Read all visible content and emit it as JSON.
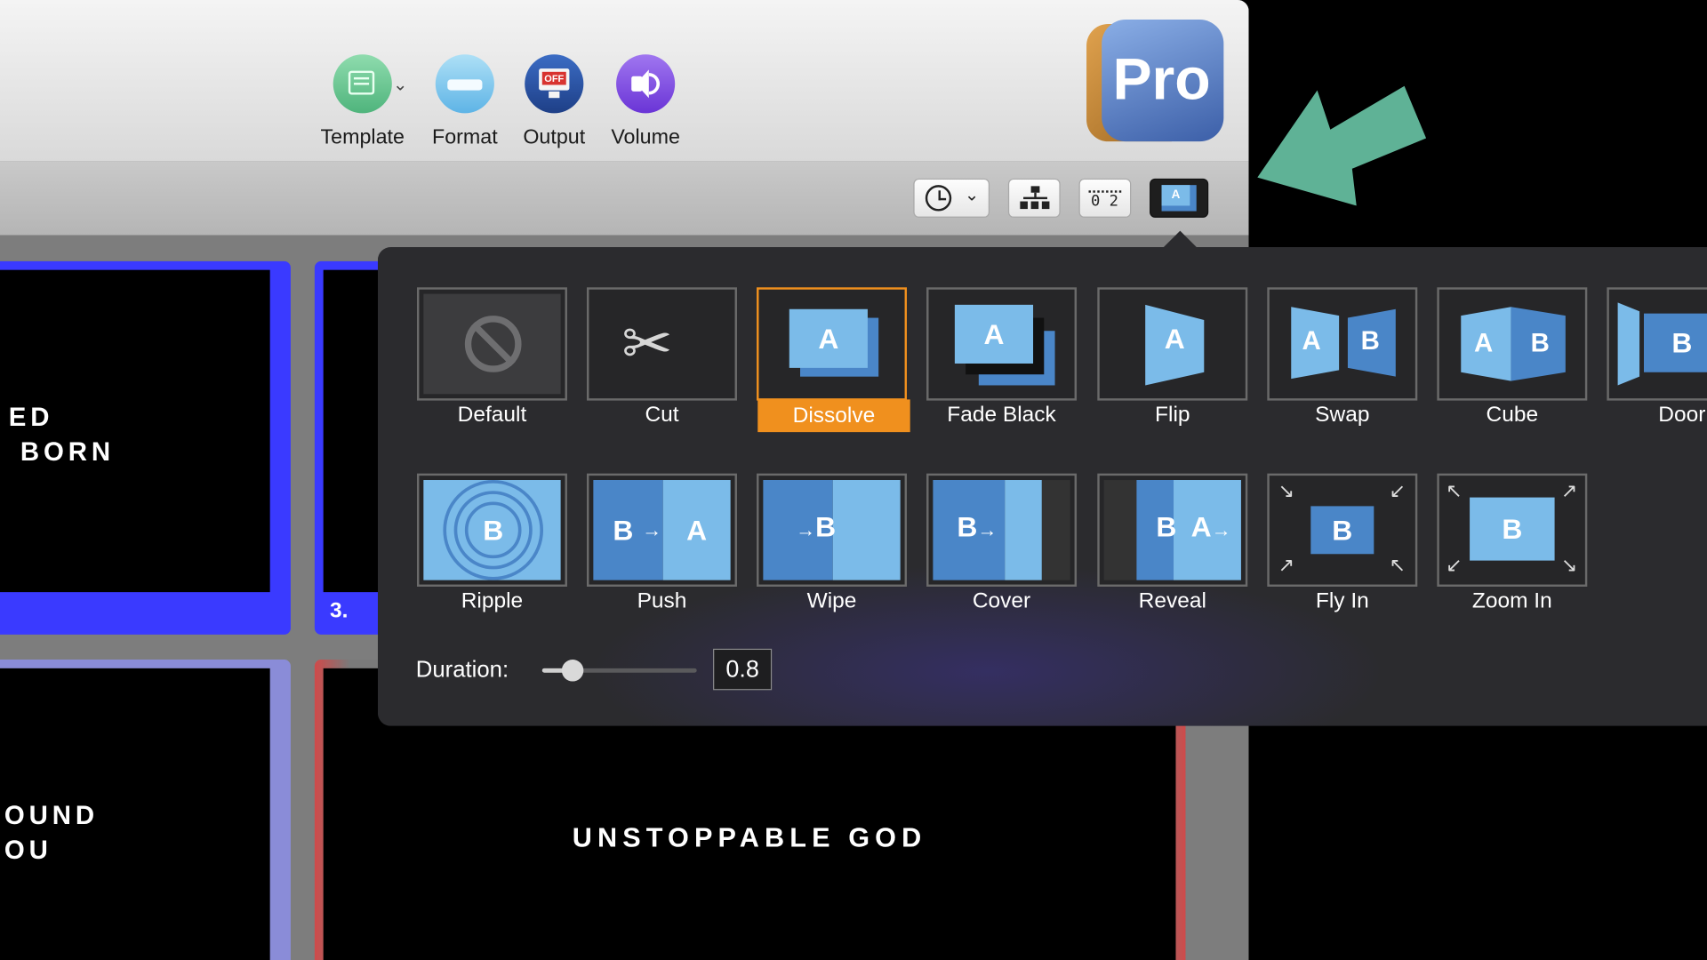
{
  "toolbar": {
    "buttons": [
      {
        "label": "Template",
        "icon": "template-icon"
      },
      {
        "label": "Format",
        "icon": "format-icon"
      },
      {
        "label": "Output",
        "icon": "output-icon",
        "badge": "OFF"
      },
      {
        "label": "Volume",
        "icon": "volume-icon"
      }
    ],
    "logo_text": "Pro"
  },
  "subbar": {
    "clock_button": "clock-icon",
    "hierarchy_button": "hierarchy-icon",
    "timecode_button": "timecode-icon",
    "timecode_text": "0 2",
    "transition_button": "transition-icon",
    "transition_letter": "A"
  },
  "slides": {
    "slide1_lines": [
      "ED",
      " BORN"
    ],
    "slide3_number": "3.",
    "slide5_lines": [
      "OUND",
      "OU"
    ],
    "slide6_text": "UNSTOPPABLE GOD"
  },
  "transitions": {
    "row1": [
      {
        "label": "Default"
      },
      {
        "label": "Cut"
      },
      {
        "label": "Dissolve",
        "selected": true,
        "letter": "A"
      },
      {
        "label": "Fade Black",
        "letter": "A"
      },
      {
        "label": "Flip",
        "letter": "A"
      },
      {
        "label": "Swap",
        "letter_a": "A",
        "letter_b": "B"
      },
      {
        "label": "Cube",
        "letter_a": "A",
        "letter_b": "B"
      },
      {
        "label": "Door",
        "letter_b": "B"
      }
    ],
    "row2": [
      {
        "label": "Ripple",
        "letter": "B"
      },
      {
        "label": "Push",
        "letter_a": "A",
        "letter_b": "B"
      },
      {
        "label": "Wipe",
        "letter_b": "B"
      },
      {
        "label": "Cover",
        "letter_b": "B"
      },
      {
        "label": "Reveal",
        "letter_a": "A",
        "letter_b": "B"
      },
      {
        "label": "Fly In",
        "letter_b": "B"
      },
      {
        "label": "Zoom In",
        "letter_b": "B"
      }
    ]
  },
  "duration": {
    "label": "Duration:",
    "value": "0.8",
    "slider_fraction": 0.2
  },
  "colors": {
    "accent": "#f0901e",
    "arrow": "#5fb296",
    "slide_blue": "#3a3aff",
    "slide_red": "#d04a4a"
  }
}
